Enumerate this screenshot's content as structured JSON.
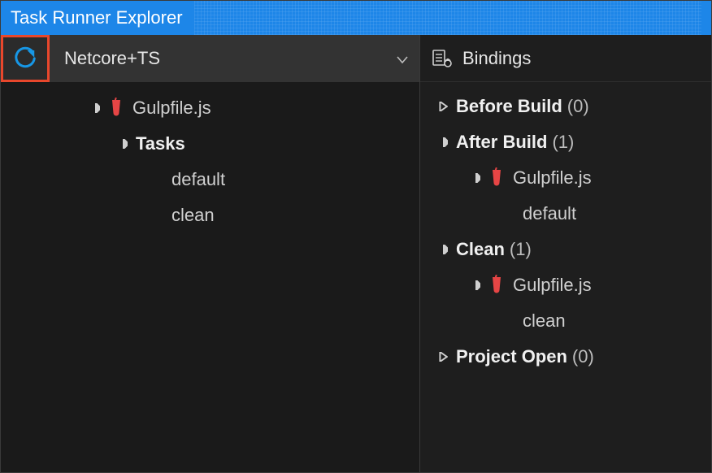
{
  "title": "Task Runner Explorer",
  "project": {
    "name": "Netcore+TS"
  },
  "tree": {
    "file": "Gulpfile.js",
    "tasksLabel": "Tasks",
    "tasks": [
      "default",
      "clean"
    ]
  },
  "bindings": {
    "header": "Bindings",
    "groups": [
      {
        "label": "Before Build",
        "count": "(0)",
        "expanded": false,
        "items": []
      },
      {
        "label": "After Build",
        "count": "(1)",
        "expanded": true,
        "items": [
          {
            "file": "Gulpfile.js",
            "task": "default"
          }
        ]
      },
      {
        "label": "Clean",
        "count": "(1)",
        "expanded": true,
        "items": [
          {
            "file": "Gulpfile.js",
            "task": "clean"
          }
        ]
      },
      {
        "label": "Project Open",
        "count": "(0)",
        "expanded": false,
        "items": []
      }
    ]
  }
}
